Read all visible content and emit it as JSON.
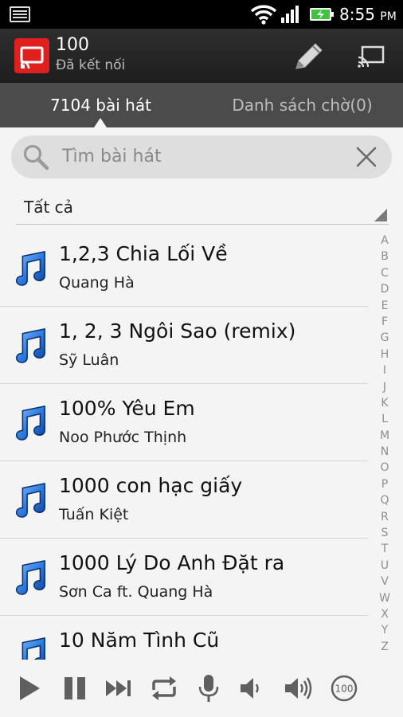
{
  "status_bar": {
    "time": "8:55",
    "ampm": "PM",
    "icons": [
      "notification-icon",
      "wifi-icon",
      "signal-icon",
      "battery-charging-icon"
    ]
  },
  "app_bar": {
    "device_name": "100",
    "connection_status": "Đã kết nối",
    "actions": [
      "edit-icon",
      "cast-icon"
    ]
  },
  "tabs": [
    {
      "label": "7104 bài hát",
      "active": true
    },
    {
      "label": "Danh sách chờ(0)",
      "active": false
    }
  ],
  "search": {
    "placeholder": "Tìm bài hát"
  },
  "filter": {
    "selected": "Tất cả"
  },
  "songs": [
    {
      "title": "1,2,3 Chia Lối Về",
      "artist": "Quang Hà"
    },
    {
      "title": "1, 2, 3 Ngôi Sao (remix)",
      "artist": "Sỹ Luân"
    },
    {
      "title": "100% Yêu Em",
      "artist": "Noo Phước Thịnh"
    },
    {
      "title": "1000 con hạc giấy",
      "artist": "Tuấn Kiệt"
    },
    {
      "title": "1000 Lý Do Anh Đặt ra",
      "artist": "Sơn Ca ft. Quang Hà"
    },
    {
      "title": "10 Năm Tình Cũ",
      "artist": ""
    }
  ],
  "alphabet": [
    "A",
    "B",
    "C",
    "D",
    "E",
    "F",
    "G",
    "H",
    "I",
    "J",
    "K",
    "L",
    "M",
    "N",
    "O",
    "P",
    "Q",
    "R",
    "S",
    "T",
    "U",
    "V",
    "W",
    "X",
    "Y",
    "Z"
  ],
  "player": {
    "buttons": [
      "play-icon",
      "pause-icon",
      "next-icon",
      "repeat-icon",
      "microphone-icon",
      "volume-down-icon",
      "volume-up-icon",
      "counter-icon"
    ],
    "counter_label": "100"
  },
  "colors": {
    "brand_red": "#e01f1f",
    "note_blue": "#2f7de0",
    "tab_bar": "#4b4b4b",
    "app_bar": "#262626"
  }
}
